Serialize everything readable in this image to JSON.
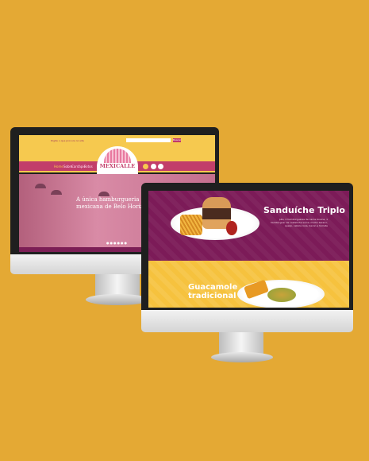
{
  "background_color": "#e4a934",
  "monitor_back": {
    "search_text": "Digite o que procura no site",
    "search_button": "Buscar",
    "logo_text": "MEXICALLE",
    "nav": [
      "Home",
      "Sobre",
      "Cardápio",
      "Fotos"
    ],
    "hero_title": "A única hamburgueria mexicana de Belo Horizonte",
    "colors": {
      "yellow": "#f6c94f",
      "pink": "#c23e6a",
      "purple": "#7c1e55"
    }
  },
  "monitor_front": {
    "dish1_title": "Sanduíche Triplo",
    "dish1_desc": "pão, 2 hambúrgueres de carne bovina, 1 hambúrguer de costelinha suína, molho texano, queijo, cebola roxa, bacon e tomate",
    "dish2_title": "Guacamole tradicional",
    "colors": {
      "purple": "#7c1b58",
      "yellow": "#f6c23e"
    }
  }
}
